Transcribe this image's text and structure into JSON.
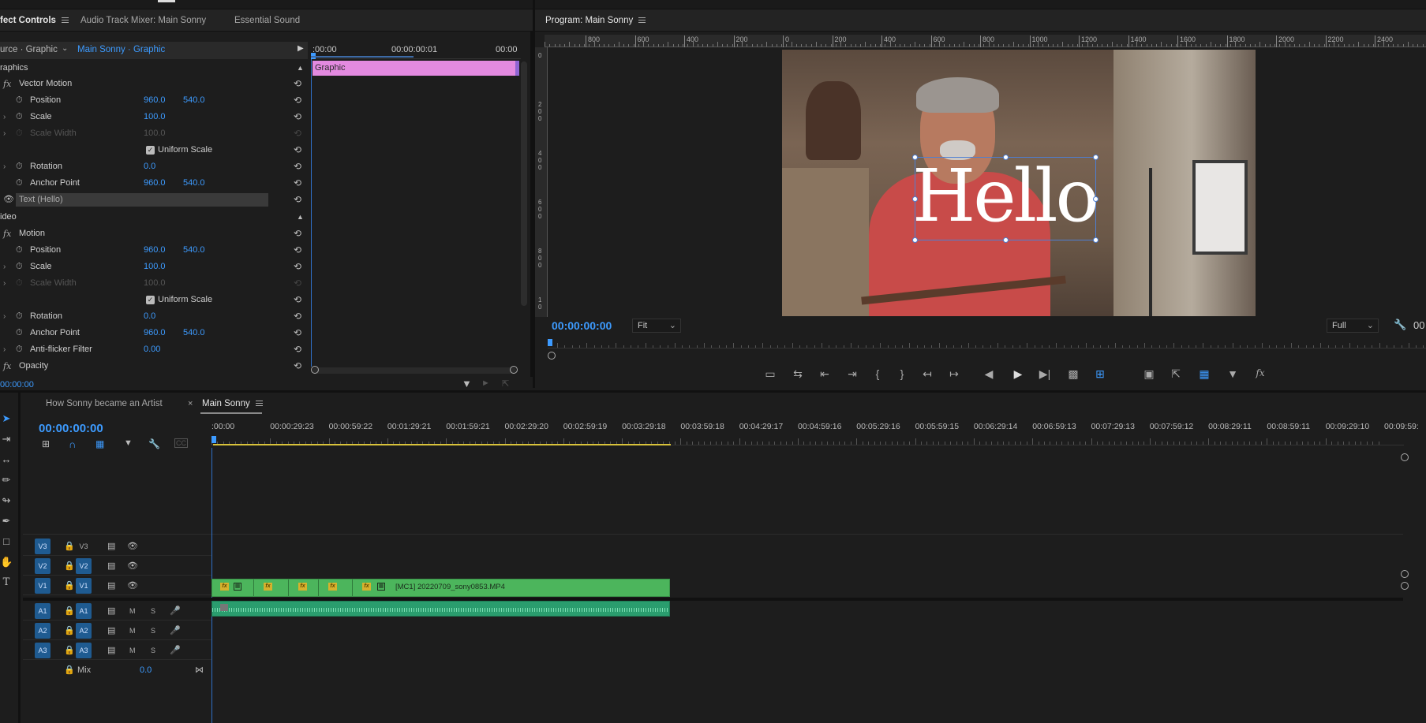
{
  "effect_panel": {
    "tabs": [
      "fect Controls",
      "Audio Track Mixer: Main Sonny",
      "Essential Sound"
    ],
    "source_label": "urce · Graphic",
    "clip_label": "Main Sonny · Graphic",
    "timecode_start": ":00:00",
    "timecode_mid": "00:00:00:01",
    "timecode_end": "00:00",
    "graphic_clip_label": "Graphic",
    "section_graphics": "raphics",
    "section_video": "ideo",
    "rows_graphics": [
      {
        "label": "Vector Motion",
        "kind": "fx"
      },
      {
        "label": "Position",
        "v1": "960.0",
        "v2": "540.0"
      },
      {
        "label": "Scale",
        "v1": "100.0",
        "twirl": true
      },
      {
        "label": "Scale Width",
        "v1": "100.0",
        "twirl": true,
        "dim": true
      },
      {
        "label": "Uniform Scale",
        "kind": "check"
      },
      {
        "label": "Rotation",
        "v1": "0.0",
        "twirl": true
      },
      {
        "label": "Anchor Point",
        "v1": "960.0",
        "v2": "540.0"
      },
      {
        "label": "Text (Hello)",
        "kind": "text"
      }
    ],
    "rows_video": [
      {
        "label": "Motion",
        "kind": "fx"
      },
      {
        "label": "Position",
        "v1": "960.0",
        "v2": "540.0"
      },
      {
        "label": "Scale",
        "v1": "100.0",
        "twirl": true
      },
      {
        "label": "Scale Width",
        "v1": "100.0",
        "twirl": true,
        "dim": true
      },
      {
        "label": "Uniform Scale",
        "kind": "check"
      },
      {
        "label": "Rotation",
        "v1": "0.0",
        "twirl": true
      },
      {
        "label": "Anchor Point",
        "v1": "960.0",
        "v2": "540.0"
      },
      {
        "label": "Anti-flicker Filter",
        "v1": "0.00",
        "twirl": true
      },
      {
        "label": "Opacity",
        "kind": "fx"
      }
    ],
    "footer_timecode": "00:00:00"
  },
  "program_monitor": {
    "title": "Program: Main Sonny",
    "ruler_h": [
      "800",
      "600",
      "400",
      "200",
      "0",
      "200",
      "400",
      "600",
      "800",
      "1000",
      "1200",
      "1400",
      "1600",
      "1800",
      "2000",
      "2200",
      "2400"
    ],
    "ruler_v": [
      "0",
      "2\n0\n0",
      "4\n0\n0",
      "6\n0\n0",
      "8\n0\n0",
      "1\n0"
    ],
    "overlay_text": "Hello",
    "timecode": "00:00:00:00",
    "zoom": "Fit",
    "quality": "Full",
    "timecode_right": "00"
  },
  "timeline": {
    "tabs": [
      "How Sonny became an Artist",
      "Main Sonny"
    ],
    "timecode": "00:00:00:00",
    "ruler": [
      ":00:00",
      "00:00:29:23",
      "00:00:59:22",
      "00:01:29:21",
      "00:01:59:21",
      "00:02:29:20",
      "00:02:59:19",
      "00:03:29:18",
      "00:03:59:18",
      "00:04:29:17",
      "00:04:59:16",
      "00:05:29:16",
      "00:05:59:15",
      "00:06:29:14",
      "00:06:59:13",
      "00:07:29:13",
      "00:07:59:12",
      "00:08:29:11",
      "00:08:59:11",
      "00:09:29:10",
      "00:09:59:"
    ],
    "video_tracks": [
      {
        "src": "V3",
        "name": "V3"
      },
      {
        "src": "V2",
        "name": "V2"
      },
      {
        "src": "V1",
        "name": "V1"
      }
    ],
    "audio_tracks": [
      {
        "src": "A1",
        "name": "A1",
        "m": "M",
        "s": "S"
      },
      {
        "src": "A2",
        "name": "A2",
        "m": "M",
        "s": "S"
      },
      {
        "src": "A3",
        "name": "A3",
        "m": "M",
        "s": "S"
      }
    ],
    "mix_label": "Mix",
    "mix_value": "0.0",
    "clip_name": "[MC1] 20220709_sony0853.MP4",
    "fx_label": "fx"
  },
  "colors": {
    "accent": "#3d9bff",
    "graphic_clip": "#e38ae0",
    "video_clip": "#4cb55c",
    "audio_clip": "#2a9d6e",
    "track_target": "#1f5b91"
  }
}
